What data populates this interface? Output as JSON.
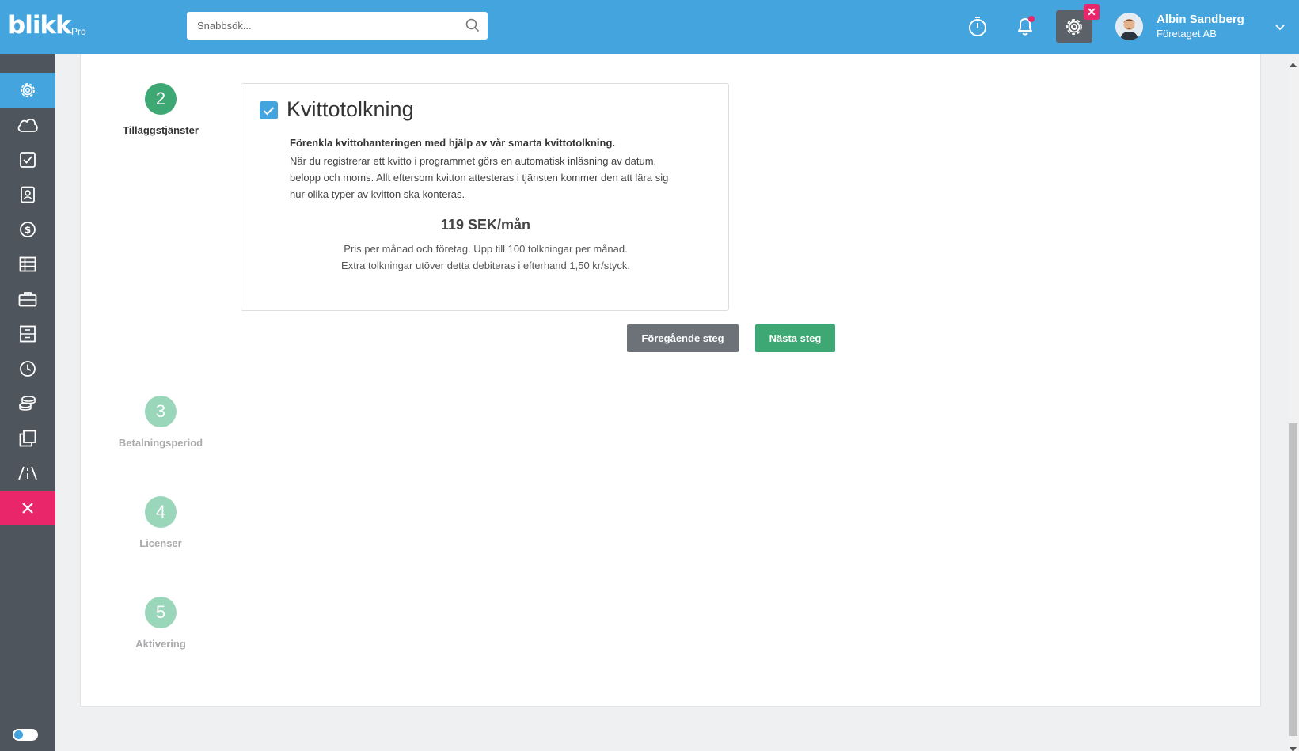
{
  "header": {
    "logo": "blikk",
    "logo_suffix": "Pro",
    "search_placeholder": "Snabbsök...",
    "user_name": "Albin Sandberg",
    "user_company": "Företaget AB"
  },
  "sidebar": {
    "items": [
      {
        "icon": "gear-icon",
        "active": true
      },
      {
        "icon": "cloud-icon"
      },
      {
        "icon": "checkbox-icon"
      },
      {
        "icon": "contacts-icon"
      },
      {
        "icon": "dollar-icon"
      },
      {
        "icon": "table-icon"
      },
      {
        "icon": "briefcase-icon"
      },
      {
        "icon": "archive-icon"
      },
      {
        "icon": "clock-icon"
      },
      {
        "icon": "coins-icon"
      },
      {
        "icon": "copy-icon"
      },
      {
        "icon": "road-icon"
      },
      {
        "icon": "close-icon",
        "close": true
      }
    ]
  },
  "steps": [
    {
      "number": "2",
      "label": "Tilläggstjänster",
      "state": "done"
    },
    {
      "number": "3",
      "label": "Betalningsperiod",
      "state": "todo"
    },
    {
      "number": "4",
      "label": "Licenser",
      "state": "todo"
    },
    {
      "number": "5",
      "label": "Aktivering",
      "state": "todo"
    }
  ],
  "feature": {
    "checked": true,
    "title": "Kvittotolkning",
    "lead": "Förenkla kvittohanteringen med hjälp av vår smarta kvittotolkning.",
    "description": "När du registrerar ett kvitto i programmet görs en automatisk inläsning av datum, belopp och moms. Allt eftersom kvitton attesteras i tjänsten kommer den att lära sig hur olika typer av kvitton ska konteras.",
    "price": "119 SEK/mån",
    "price_note_1": "Pris per månad och företag. Upp till 100 tolkningar per månad.",
    "price_note_2": "Extra tolkningar utöver detta debiteras i efterhand 1,50 kr/styck."
  },
  "buttons": {
    "previous": "Föregående steg",
    "next": "Nästa steg"
  },
  "colors": {
    "primary": "#44a4de",
    "sidebar": "#4f555c",
    "success": "#3da874",
    "danger": "#e9266a"
  }
}
